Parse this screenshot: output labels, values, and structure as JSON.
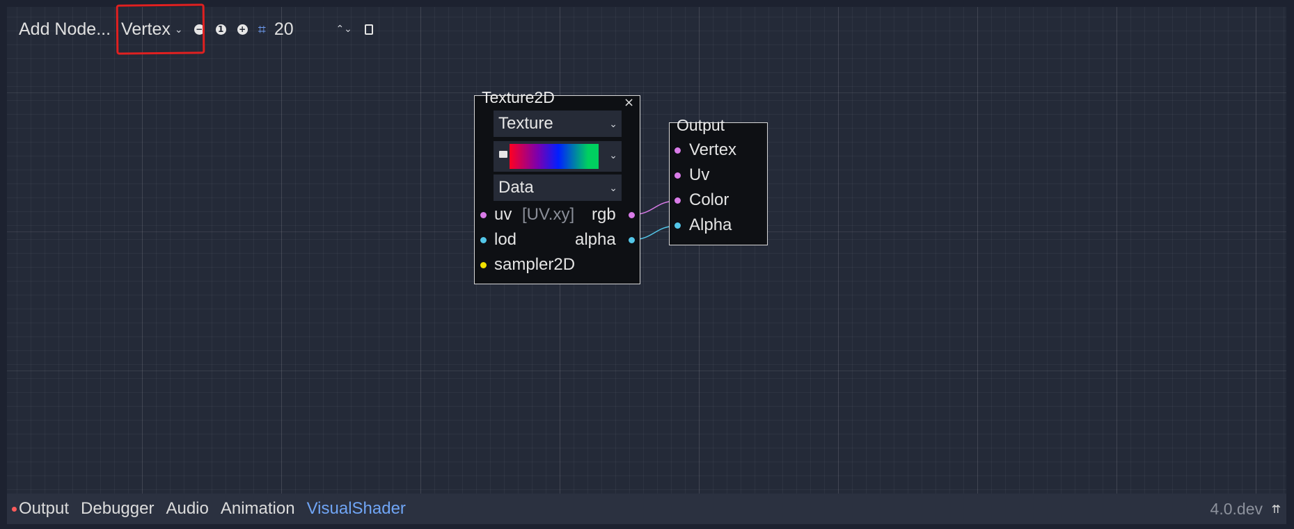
{
  "toolbar": {
    "add_node_label": "Add Node...",
    "mode_value": "Vertex",
    "zoom_out_icon": "minus-circle-icon",
    "zoom_reset_icon": "one-circle-icon",
    "zoom_in_icon": "plus-circle-icon",
    "snap_icon": "grid-snap-icon",
    "snap_value": "20",
    "spin_arrows": "⌃⌄",
    "doc_icon": "document-icon"
  },
  "annotation": {
    "color": "#e02020"
  },
  "nodes": {
    "texture2d": {
      "title": "Texture2D",
      "close_glyph": "×",
      "source_value": "Texture",
      "texture_type_value": "Data",
      "preview_icon": "image-icon",
      "inputs": [
        {
          "name": "uv",
          "default_hint": "[UV.xy]",
          "color": "#d97be8"
        },
        {
          "name": "lod",
          "color": "#53c6e8"
        },
        {
          "name": "sampler2D",
          "color": "#f0e000"
        }
      ],
      "outputs": [
        {
          "name": "rgb",
          "color": "#d97be8"
        },
        {
          "name": "alpha",
          "color": "#53c6e8"
        }
      ]
    },
    "output": {
      "title": "Output",
      "inputs": [
        {
          "name": "Vertex",
          "color": "#d97be8"
        },
        {
          "name": "Uv",
          "color": "#d97be8"
        },
        {
          "name": "Color",
          "color": "#d97be8"
        },
        {
          "name": "Alpha",
          "color": "#53c6e8"
        }
      ]
    }
  },
  "connections": [
    {
      "from": "texture2d.rgb",
      "to": "output.Color",
      "color": "#d97be8"
    },
    {
      "from": "texture2d.alpha",
      "to": "output.Alpha",
      "color": "#53c6e8"
    }
  ],
  "bottom_tabs": [
    {
      "label": "Output",
      "has_alert_dot": true
    },
    {
      "label": "Debugger"
    },
    {
      "label": "Audio"
    },
    {
      "label": "Animation"
    },
    {
      "label": "VisualShader",
      "active": true
    }
  ],
  "version": "4.0.dev",
  "pin_glyph": "⇈",
  "colors": {
    "accent": "#70a5f5",
    "alert": "#ff5b5b",
    "background": "#1d2230"
  }
}
